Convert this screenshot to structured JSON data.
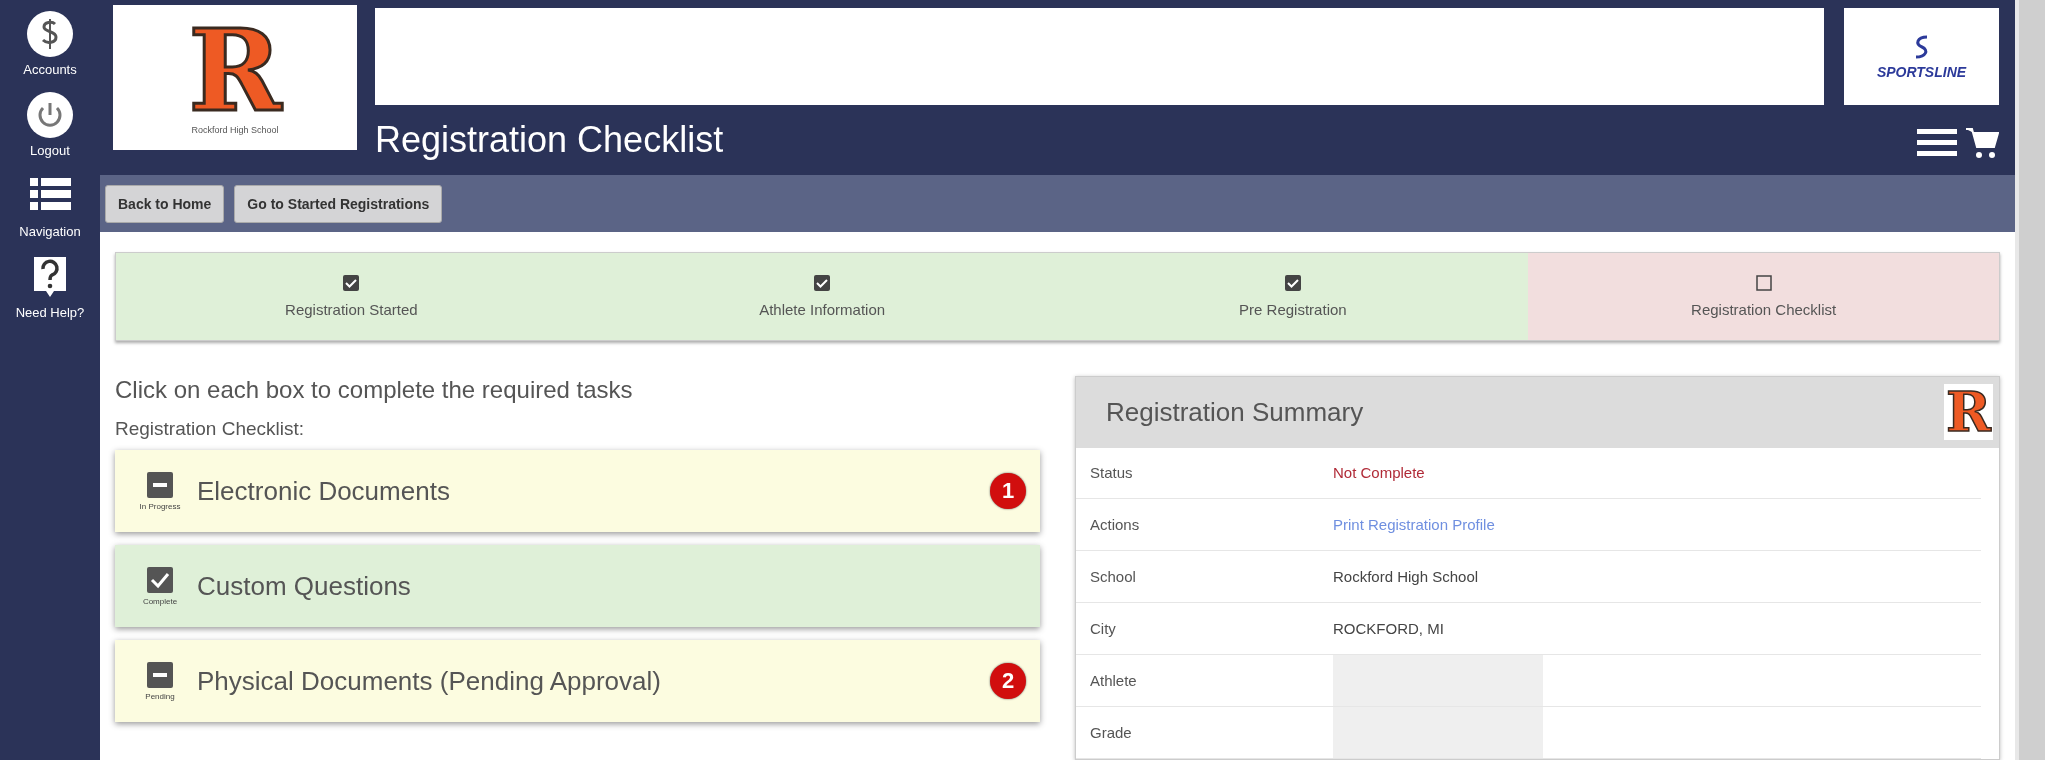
{
  "sidebar": {
    "items": [
      {
        "kind": "account",
        "label": "Accounts"
      },
      {
        "kind": "logout",
        "label": "Logout"
      },
      {
        "kind": "navigation",
        "label": "Navigation"
      },
      {
        "kind": "help",
        "label": "Need Help?"
      }
    ]
  },
  "header": {
    "school_logo": {
      "letter": "R",
      "caption": "Rockford High School"
    },
    "brand_logo": {
      "text": "SPORTSLINE"
    },
    "title": "Registration Checklist"
  },
  "toolbar": {
    "buttons": [
      "Back to Home",
      "Go to Started Registrations"
    ]
  },
  "steps": [
    {
      "label": "Registration Started",
      "checked": true
    },
    {
      "label": "Athlete Information",
      "checked": true
    },
    {
      "label": "Pre Registration",
      "checked": true
    },
    {
      "label": "Registration Checklist",
      "checked": false
    }
  ],
  "instructions": "Click on each box to complete the required tasks",
  "checklist": {
    "heading": "Registration Checklist:",
    "items": [
      {
        "kind": "in_progress",
        "status_label": "In Progress",
        "title": "Electronic Documents",
        "badge": "1"
      },
      {
        "kind": "complete",
        "status_label": "Complete",
        "title": "Custom Questions"
      },
      {
        "kind": "pending",
        "status_label": "Pending",
        "title": "Physical Documents (Pending Approval)",
        "badge": "2"
      }
    ]
  },
  "summary": {
    "title": "Registration Summary",
    "logo_letter": "R",
    "rows": [
      {
        "label": "Status",
        "kind": "status",
        "value": "Not Complete"
      },
      {
        "label": "Actions",
        "kind": "link",
        "value": "Print Registration Profile"
      },
      {
        "label": "School",
        "kind": "text",
        "value": "Rockford High School"
      },
      {
        "label": "City",
        "kind": "text",
        "value": "ROCKFORD, MI"
      },
      {
        "label": "Athlete",
        "kind": "redacted"
      },
      {
        "label": "Grade",
        "kind": "redacted"
      }
    ]
  }
}
